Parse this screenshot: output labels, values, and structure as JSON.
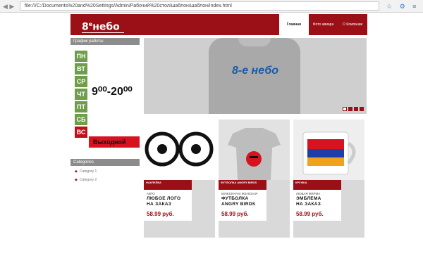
{
  "browser": {
    "url": "file:///C:/Documents%20and%20Settings/Admin/Рабочий%20стол/шаблон/шаблон/index.html",
    "nav_glyphs": "◀ ▶",
    "icons_glyphs": "☆ ⚙ ≡"
  },
  "header": {
    "logo_num": "8",
    "logo_sup": "e",
    "logo_word": "небо",
    "menu": [
      {
        "label": "Главная"
      },
      {
        "label": "Фото авиара"
      },
      {
        "label": "О Компании"
      }
    ]
  },
  "sidebar": {
    "schedule_title": "График работы",
    "days": [
      "ПН",
      "ВТ",
      "СР",
      "ЧТ",
      "ПТ",
      "СБ",
      "ВС"
    ],
    "hours": "9⁰⁰-20⁰⁰",
    "day_off": "Выходной",
    "categories_title": "Categories",
    "categories": [
      "Category 1",
      "Category 2"
    ]
  },
  "slider": {
    "shirt_logo": "8-е небо",
    "dots": 3
  },
  "products": [
    {
      "tag": "НАКЛЕЙКА",
      "category": "АВТО",
      "name_line1": "ЛЮБОЕ ЛОГО",
      "name_line2": "НА ЗАКАЗ",
      "price": "58.99 руб."
    },
    {
      "tag": "ФУТБОЛКА ANGRY BIRDS",
      "category": "МУЖСКАЯ И ЖЕНСКАЯ",
      "name_line1": "ФУТБОЛКА",
      "name_line2": "ANGRY BIRDS",
      "price": "58.99 руб."
    },
    {
      "tag": "КРУЖКА",
      "category": "ЛЮБАЯ ФИРМА",
      "name_line1": "ЭМБЛЕМА",
      "name_line2": "НА ЗАКАЗ",
      "price": "58.99 руб."
    }
  ],
  "colors": {
    "brand_red": "#9b0f16",
    "schedule_green": "#6f9d4a",
    "dayoff_red": "#d6131f"
  }
}
